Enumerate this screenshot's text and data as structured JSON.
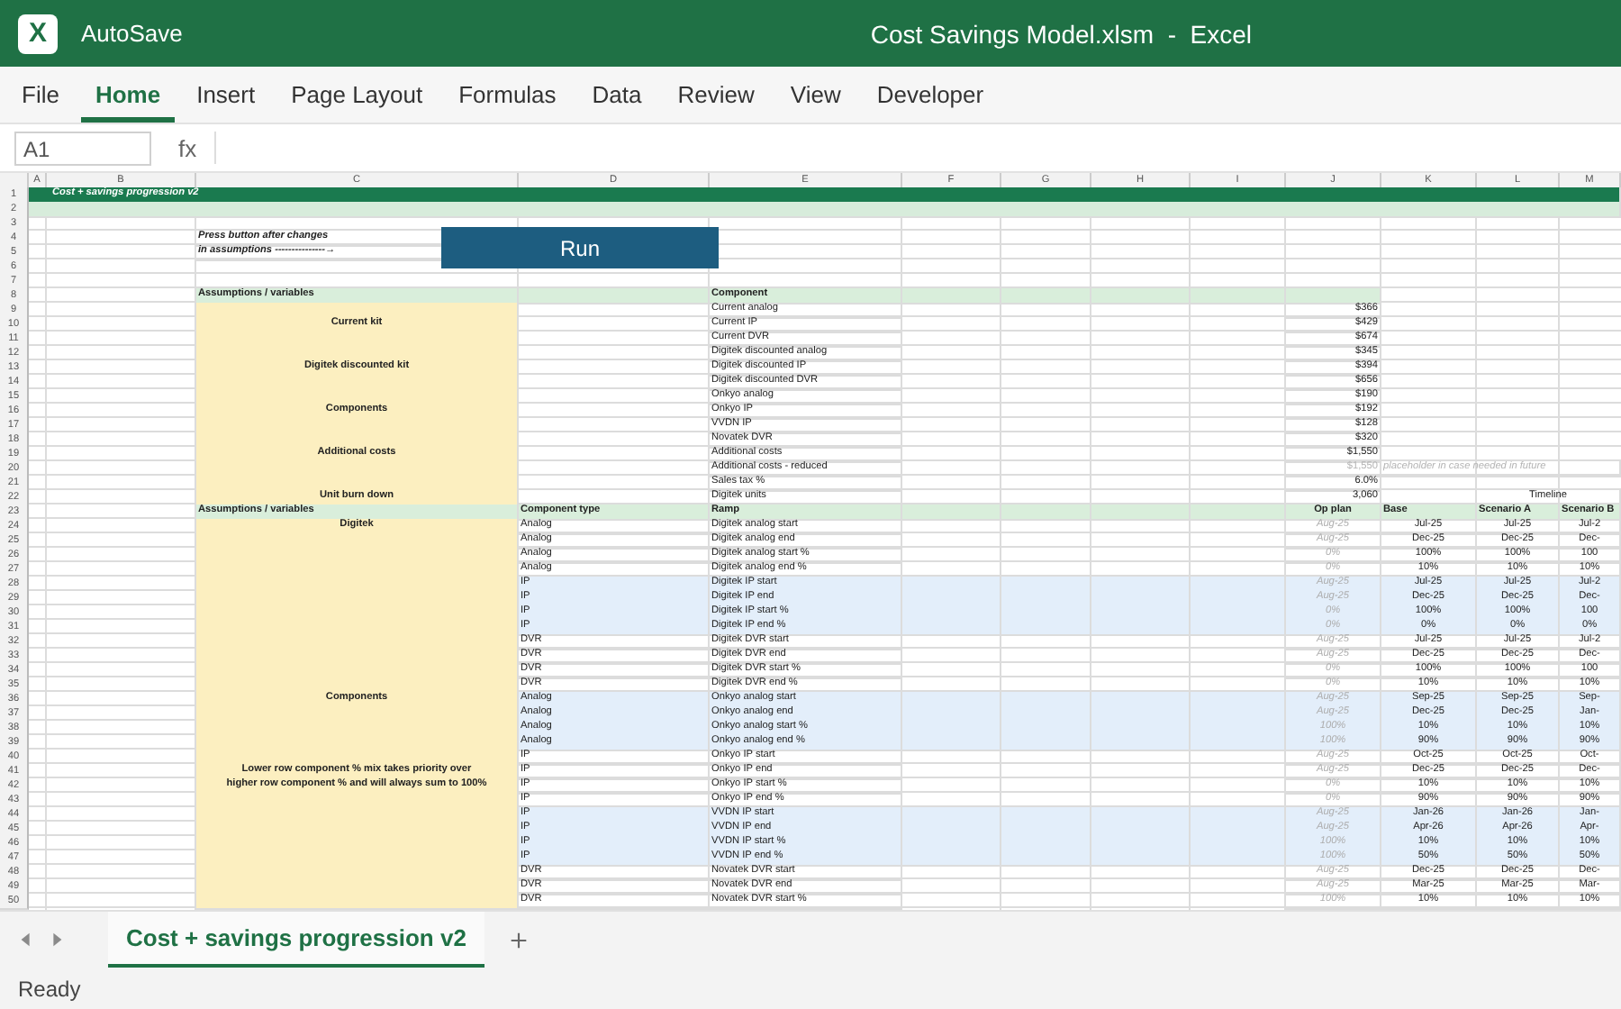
{
  "window": {
    "logo": "X",
    "autosave_label": "AutoSave",
    "title": "Cost Savings Model.xlsm  -  Excel"
  },
  "ribbon_tabs": [
    {
      "label": "File",
      "selected": false
    },
    {
      "label": "Home",
      "selected": true
    },
    {
      "label": "Insert",
      "selected": false
    },
    {
      "label": "Page Layout",
      "selected": false
    },
    {
      "label": "Formulas",
      "selected": false
    },
    {
      "label": "Data",
      "selected": false
    },
    {
      "label": "Review",
      "selected": false
    },
    {
      "label": "View",
      "selected": false
    },
    {
      "label": "Developer",
      "selected": false
    }
  ],
  "formula_bar": {
    "name_box": "A1",
    "function_label": "fx"
  },
  "run_button": {
    "label": "Run"
  },
  "sheet": {
    "columns": [
      "A",
      "B",
      "C",
      "D",
      "E",
      "F",
      "G",
      "H",
      "I",
      "J",
      "K",
      "L",
      "M"
    ],
    "rows": [
      {
        "number": "1",
        "kind": "title",
        "cells": {
          "B": "Cost + savings progression v2"
        }
      },
      {
        "number": "2",
        "kind": "band"
      },
      {
        "number": "3",
        "kind": "blank"
      },
      {
        "number": "4",
        "kind": "note",
        "cells": {
          "C": "Press button after changes"
        }
      },
      {
        "number": "5",
        "kind": "note",
        "cells": {
          "C": "in assumptions ---------------→"
        }
      },
      {
        "number": "6",
        "kind": "blank"
      },
      {
        "number": "7",
        "kind": "blank"
      },
      {
        "number": "8",
        "kind": "section_header",
        "cells": {
          "C": "Assumptions / variables",
          "E": "Component"
        }
      },
      {
        "number": "9",
        "kind": "cost",
        "muted": false,
        "cells": {
          "E": "Current analog",
          "J": "$366"
        }
      },
      {
        "number": "10",
        "kind": "cost",
        "muted": false,
        "cells": {
          "C": "Current kit",
          "E": "Current IP",
          "J": "$429"
        }
      },
      {
        "number": "11",
        "kind": "cost",
        "muted": false,
        "cells": {
          "E": "Current DVR",
          "J": "$674"
        }
      },
      {
        "number": "12",
        "kind": "cost",
        "muted": false,
        "cells": {
          "E": "Digitek discounted analog",
          "J": "$345"
        }
      },
      {
        "number": "13",
        "kind": "cost",
        "muted": false,
        "cells": {
          "C": "Digitek discounted kit",
          "E": "Digitek discounted IP",
          "J": "$394"
        }
      },
      {
        "number": "14",
        "kind": "cost",
        "muted": false,
        "cells": {
          "E": "Digitek discounted DVR",
          "J": "$656"
        }
      },
      {
        "number": "15",
        "kind": "cost",
        "muted": false,
        "cells": {
          "E": "Onkyo analog",
          "J": "$190"
        }
      },
      {
        "number": "16",
        "kind": "cost",
        "muted": false,
        "cells": {
          "C": "Components",
          "E": "Onkyo IP",
          "J": "$192"
        }
      },
      {
        "number": "17",
        "kind": "cost",
        "muted": false,
        "cells": {
          "E": "VVDN IP",
          "J": "$128"
        }
      },
      {
        "number": "18",
        "kind": "cost",
        "muted": false,
        "cells": {
          "E": "Novatek DVR",
          "J": "$320"
        }
      },
      {
        "number": "19",
        "kind": "cost",
        "muted": false,
        "cells": {
          "C": "Additional costs",
          "E": "Additional costs",
          "J": "$1,550"
        }
      },
      {
        "number": "20",
        "kind": "cost",
        "muted": true,
        "cells": {
          "E": "Additional costs - reduced",
          "J": "$1,550",
          "K": "placeholder in case needed in future"
        }
      },
      {
        "number": "21",
        "kind": "cost",
        "muted": false,
        "cells": {
          "E": "Sales tax %",
          "J": "6.0%"
        }
      },
      {
        "number": "22",
        "kind": "cost",
        "muted": false,
        "cells": {
          "C": "Unit burn down",
          "E": "Digitek units",
          "J": "3,060",
          "L": "Timeline"
        }
      },
      {
        "number": "23",
        "kind": "table_header",
        "cells": {
          "C": "Assumptions / variables",
          "D": "Component type",
          "E": "Ramp",
          "J": "Op plan",
          "K": "Base",
          "L": "Scenario A",
          "M": "Scenario B"
        }
      },
      {
        "number": "24",
        "kind": "ramp",
        "highlighted": false,
        "cells": {
          "C": "Digitek",
          "D": "Analog",
          "E": "Digitek analog start",
          "J": "Aug-25",
          "K": "Jul-25",
          "L": "Jul-25",
          "M": "Jul-2"
        }
      },
      {
        "number": "25",
        "kind": "ramp",
        "highlighted": false,
        "cells": {
          "D": "Analog",
          "E": "Digitek analog end",
          "J": "Aug-25",
          "K": "Dec-25",
          "L": "Dec-25",
          "M": "Dec-"
        }
      },
      {
        "number": "26",
        "kind": "ramp",
        "highlighted": false,
        "cells": {
          "D": "Analog",
          "E": "Digitek analog start %",
          "J": "0%",
          "K": "100%",
          "L": "100%",
          "M": "100"
        }
      },
      {
        "number": "27",
        "kind": "ramp",
        "highlighted": false,
        "cells": {
          "D": "Analog",
          "E": "Digitek analog end %",
          "J": "0%",
          "K": "10%",
          "L": "10%",
          "M": "10%"
        }
      },
      {
        "number": "28",
        "kind": "ramp",
        "highlighted": true,
        "cells": {
          "D": "IP",
          "E": "Digitek IP start",
          "J": "Aug-25",
          "K": "Jul-25",
          "L": "Jul-25",
          "M": "Jul-2"
        }
      },
      {
        "number": "29",
        "kind": "ramp",
        "highlighted": true,
        "cells": {
          "D": "IP",
          "E": "Digitek IP end",
          "J": "Aug-25",
          "K": "Dec-25",
          "L": "Dec-25",
          "M": "Dec-"
        }
      },
      {
        "number": "30",
        "kind": "ramp",
        "highlighted": true,
        "cells": {
          "D": "IP",
          "E": "Digitek IP start %",
          "J": "0%",
          "K": "100%",
          "L": "100%",
          "M": "100"
        }
      },
      {
        "number": "31",
        "kind": "ramp",
        "highlighted": true,
        "cells": {
          "D": "IP",
          "E": "Digitek IP end %",
          "J": "0%",
          "K": "0%",
          "L": "0%",
          "M": "0%"
        }
      },
      {
        "number": "32",
        "kind": "ramp",
        "highlighted": false,
        "cells": {
          "D": "DVR",
          "E": "Digitek DVR start",
          "J": "Aug-25",
          "K": "Jul-25",
          "L": "Jul-25",
          "M": "Jul-2"
        }
      },
      {
        "number": "33",
        "kind": "ramp",
        "highlighted": false,
        "cells": {
          "D": "DVR",
          "E": "Digitek DVR end",
          "J": "Aug-25",
          "K": "Dec-25",
          "L": "Dec-25",
          "M": "Dec-"
        }
      },
      {
        "number": "34",
        "kind": "ramp",
        "highlighted": false,
        "cells": {
          "D": "DVR",
          "E": "Digitek DVR start %",
          "J": "0%",
          "K": "100%",
          "L": "100%",
          "M": "100"
        }
      },
      {
        "number": "35",
        "kind": "ramp",
        "highlighted": false,
        "cells": {
          "D": "DVR",
          "E": "Digitek DVR end %",
          "J": "0%",
          "K": "10%",
          "L": "10%",
          "M": "10%"
        }
      },
      {
        "number": "36",
        "kind": "ramp",
        "highlighted": true,
        "cells": {
          "C": "Components",
          "D": "Analog",
          "E": "Onkyo analog start",
          "J": "Aug-25",
          "K": "Sep-25",
          "L": "Sep-25",
          "M": "Sep-"
        }
      },
      {
        "number": "37",
        "kind": "ramp",
        "highlighted": true,
        "cells": {
          "D": "Analog",
          "E": "Onkyo analog end",
          "J": "Aug-25",
          "K": "Dec-25",
          "L": "Dec-25",
          "M": "Jan-"
        }
      },
      {
        "number": "38",
        "kind": "ramp",
        "highlighted": true,
        "cells": {
          "D": "Analog",
          "E": "Onkyo analog start %",
          "J": "100%",
          "K": "10%",
          "L": "10%",
          "M": "10%"
        }
      },
      {
        "number": "39",
        "kind": "ramp",
        "highlighted": true,
        "cells": {
          "D": "Analog",
          "E": "Onkyo analog end %",
          "J": "100%",
          "K": "90%",
          "L": "90%",
          "M": "90%"
        }
      },
      {
        "number": "40",
        "kind": "ramp",
        "highlighted": false,
        "cells": {
          "D": "IP",
          "E": "Onkyo IP start",
          "J": "Aug-25",
          "K": "Oct-25",
          "L": "Oct-25",
          "M": "Oct-"
        }
      },
      {
        "number": "41",
        "kind": "ramp",
        "highlighted": false,
        "cells": {
          "C": "Lower row component % mix takes priority over",
          "D": "IP",
          "E": "Onkyo IP end",
          "J": "Aug-25",
          "K": "Dec-25",
          "L": "Dec-25",
          "M": "Dec-"
        }
      },
      {
        "number": "42",
        "kind": "ramp",
        "highlighted": false,
        "cells": {
          "C": "higher row component % and will always sum to 100%",
          "D": "IP",
          "E": "Onkyo IP start %",
          "J": "0%",
          "K": "10%",
          "L": "10%",
          "M": "10%"
        }
      },
      {
        "number": "43",
        "kind": "ramp",
        "highlighted": false,
        "cells": {
          "D": "IP",
          "E": "Onkyo IP end %",
          "J": "0%",
          "K": "90%",
          "L": "90%",
          "M": "90%"
        }
      },
      {
        "number": "44",
        "kind": "ramp",
        "highlighted": true,
        "cells": {
          "D": "IP",
          "E": "VVDN IP start",
          "J": "Aug-25",
          "K": "Jan-26",
          "L": "Jan-26",
          "M": "Jan-"
        }
      },
      {
        "number": "45",
        "kind": "ramp",
        "highlighted": true,
        "cells": {
          "D": "IP",
          "E": "VVDN IP end",
          "J": "Aug-25",
          "K": "Apr-26",
          "L": "Apr-26",
          "M": "Apr-"
        }
      },
      {
        "number": "46",
        "kind": "ramp",
        "highlighted": true,
        "cells": {
          "D": "IP",
          "E": "VVDN IP start %",
          "J": "100%",
          "K": "10%",
          "L": "10%",
          "M": "10%"
        }
      },
      {
        "number": "47",
        "kind": "ramp",
        "highlighted": true,
        "cells": {
          "D": "IP",
          "E": "VVDN IP end %",
          "J": "100%",
          "K": "50%",
          "L": "50%",
          "M": "50%"
        }
      },
      {
        "number": "48",
        "kind": "ramp",
        "highlighted": false,
        "cells": {
          "D": "DVR",
          "E": "Novatek DVR start",
          "J": "Aug-25",
          "K": "Dec-25",
          "L": "Dec-25",
          "M": "Dec-"
        }
      },
      {
        "number": "49",
        "kind": "ramp",
        "highlighted": false,
        "cells": {
          "D": "DVR",
          "E": "Novatek DVR end",
          "J": "Aug-25",
          "K": "Mar-25",
          "L": "Mar-25",
          "M": "Mar-"
        }
      },
      {
        "number": "50",
        "kind": "ramp",
        "highlighted": false,
        "cells": {
          "D": "DVR",
          "E": "Novatek DVR start %",
          "J": "100%",
          "K": "10%",
          "L": "10%",
          "M": "10%"
        }
      }
    ]
  },
  "sheet_tabs": [
    {
      "label": "Cost + savings progression v2",
      "selected": true
    }
  ],
  "status_bar": {
    "text": "Ready"
  }
}
